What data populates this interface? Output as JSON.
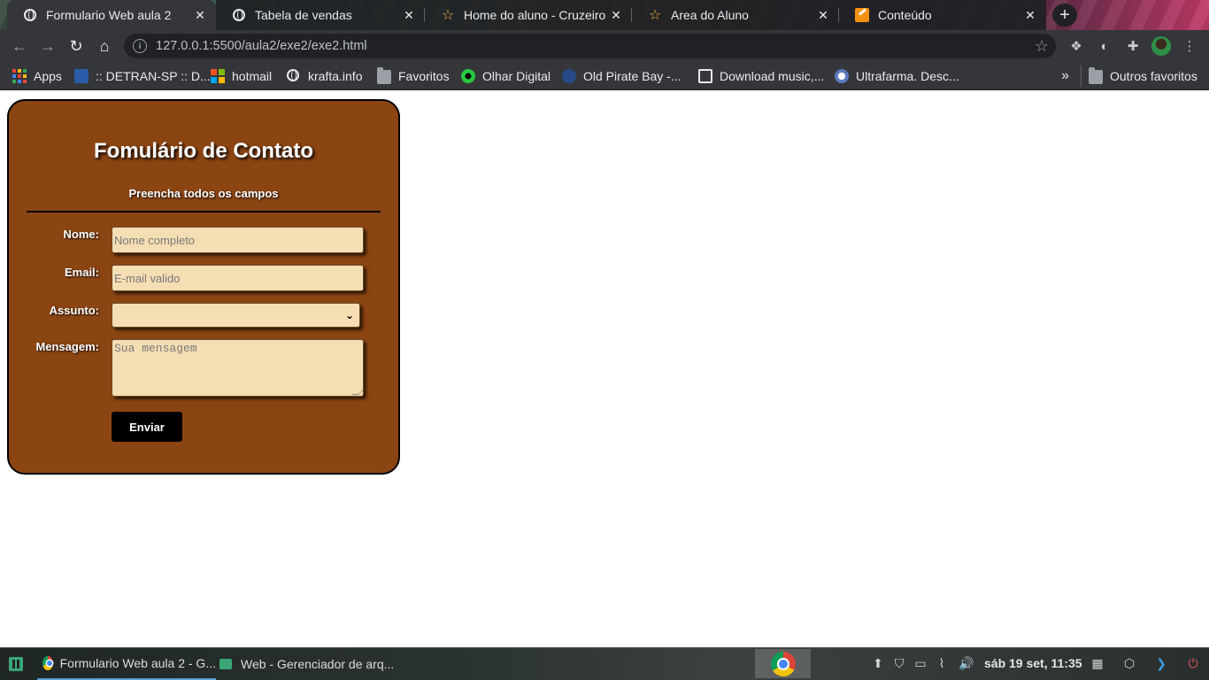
{
  "browser": {
    "tabs": [
      {
        "title": "Formulario Web aula 2",
        "icon": "globe-icon",
        "active": true
      },
      {
        "title": "Tabela de vendas",
        "icon": "globe-icon",
        "active": false
      },
      {
        "title": "Home do aluno - Cruzeiro do",
        "icon": "star-icon",
        "active": false
      },
      {
        "title": "Area do Aluno",
        "icon": "star-icon",
        "active": false
      },
      {
        "title": "Conteúdo",
        "icon": "edit-icon",
        "active": false
      }
    ],
    "new_tab": "+",
    "address": "127.0.0.1:5500/aula2/exe2/exe2.html"
  },
  "bookmarks": [
    {
      "label": "Apps",
      "icon": "apps-grid-icon"
    },
    {
      "label": ":: DETRAN-SP :: D...",
      "icon": "detran-icon"
    },
    {
      "label": "hotmail",
      "icon": "microsoft-icon"
    },
    {
      "label": "krafta.info",
      "icon": "globe-icon"
    },
    {
      "label": "Favoritos",
      "icon": "folder-icon"
    },
    {
      "label": "Olhar Digital",
      "icon": "olhar-digital-icon"
    },
    {
      "label": "Old Pirate Bay -...",
      "icon": "pirate-icon"
    },
    {
      "label": "Download music,...",
      "icon": "music-icon"
    },
    {
      "label": "Ultrafarma. Desc...",
      "icon": "ultrafarma-icon"
    }
  ],
  "bookmarks_overflow": "»",
  "other_bookmarks": "Outros favoritos",
  "form": {
    "title": "Fomulário de Contato",
    "subtitle": "Preencha todos os campos",
    "name_label": "Nome:",
    "name_placeholder": "Nome completo",
    "email_label": "Email:",
    "email_placeholder": "E-mail valido",
    "subject_label": "Assunto:",
    "subject_value": "",
    "message_label": "Mensagem:",
    "message_placeholder": "Sua mensagem",
    "submit_label": "Enviar",
    "colors": {
      "card": "#8b4513",
      "field": "#f5deb3",
      "button": "#000000"
    }
  },
  "taskbar": {
    "windows": [
      {
        "title": "Formulario Web aula 2 - G...",
        "icon": "chrome-icon",
        "active": true
      },
      {
        "title": "Web - Gerenciador de arq...",
        "icon": "file-manager-icon",
        "active": false
      }
    ],
    "clock": "sáb 19 set, 11:35"
  }
}
